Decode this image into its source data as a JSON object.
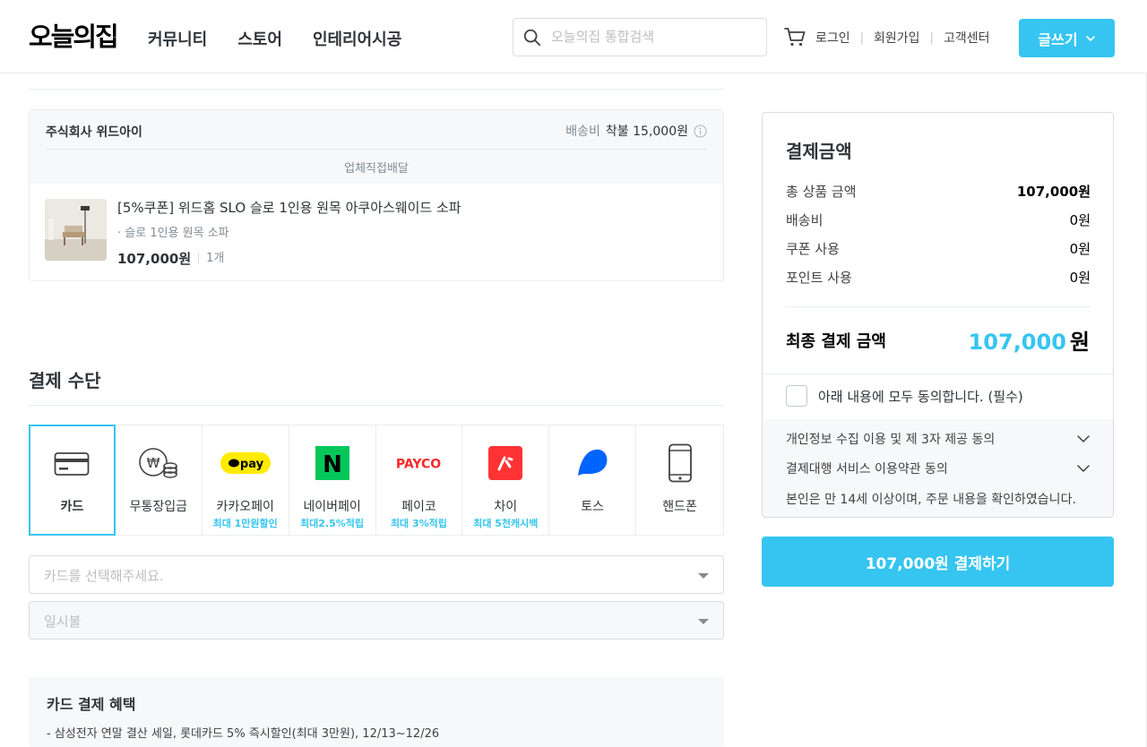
{
  "header": {
    "logo": "오늘의집",
    "nav": [
      "커뮤니티",
      "스토어",
      "인테리어시공"
    ],
    "search_placeholder": "오늘의집 통합검색",
    "links": [
      "로그인",
      "회원가입",
      "고객센터"
    ],
    "write_label": "글쓰기"
  },
  "order": {
    "vendor": "주식회사 위드아이",
    "ship_label": "배송비",
    "ship_value": "착불 15,000원",
    "delivery_type": "업체직접배달",
    "product_name": "[5%쿠폰] 위드홈 SLO 슬로 1인용 원목 아쿠아스웨이드 소파",
    "product_option": "· 슬로 1인용 원목 소파",
    "product_price": "107,000원",
    "product_qty": "1개"
  },
  "payment": {
    "title": "결제 수단",
    "methods": [
      {
        "label": "카드",
        "sub": "",
        "icon": "card-icon",
        "selected": true
      },
      {
        "label": "무통장입금",
        "sub": "",
        "icon": "bank-coin-icon"
      },
      {
        "label": "카카오페이",
        "sub": "최대 1만원할인",
        "icon": "kakaopay-icon",
        "logo_text": "pay"
      },
      {
        "label": "네이버페이",
        "sub": "최대2.5%적립",
        "icon": "naver-icon",
        "logo_text": "N"
      },
      {
        "label": "페이코",
        "sub": "최대 3%적립",
        "icon": "payco-icon",
        "logo_text": "PAYCO"
      },
      {
        "label": "차이",
        "sub": "최대 5천캐시백",
        "icon": "chai-icon"
      },
      {
        "label": "토스",
        "sub": "",
        "icon": "toss-icon"
      },
      {
        "label": "핸드폰",
        "sub": "",
        "icon": "phone-icon"
      }
    ],
    "card_select_placeholder": "카드를 선택해주세요.",
    "installment_placeholder": "일시불",
    "benefit_title": "카드 결제 혜택",
    "benefit_item": "- 삼성전자 연말 결산 세일, 롯데카드 5% 즉시할인(최대 3만원), 12/13~12/26"
  },
  "summary": {
    "title": "결제금액",
    "rows": [
      {
        "label": "총 상품 금액",
        "value": "107,000원"
      },
      {
        "label": "배송비",
        "value": "0원"
      },
      {
        "label": "쿠폰 사용",
        "value": "0원"
      },
      {
        "label": "포인트 사용",
        "value": "0원"
      }
    ],
    "final_label": "최종 결제 금액",
    "final_amount": "107,000",
    "final_unit": "원",
    "agree_all": "아래 내용에 모두 동의합니다. (필수)",
    "terms": [
      "개인정보 수집 이용 및 제 3자 제공 동의",
      "결제대행 서비스 이용약관 동의"
    ],
    "terms_note": "본인은 만 14세 이상이며, 주문 내용을 확인하였습니다.",
    "pay_button": "107,000원 결제하기"
  },
  "colors": {
    "accent": "#35c5f0",
    "kakao": "#ffeb00",
    "naver": "#03c75a",
    "payco": "#fa2828",
    "chai": "#ff3333",
    "toss": "#0064ff"
  }
}
